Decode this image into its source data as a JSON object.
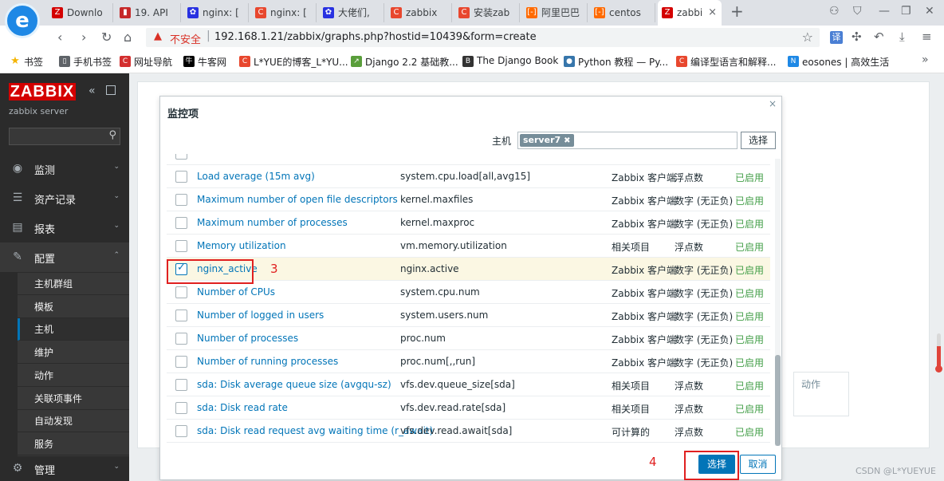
{
  "browser": {
    "tabs": [
      {
        "label": "Downlo",
        "icon": "zabbix-z-icon",
        "color": "#d40000"
      },
      {
        "label": "19. API",
        "icon": "book-icon",
        "color": "#c62828"
      },
      {
        "label": "nginx: [",
        "icon": "baidu-paw-icon",
        "color": "#2932e1"
      },
      {
        "label": "nginx: [",
        "icon": "csdn-c-icon",
        "color": "#e8472e"
      },
      {
        "label": "大佬们,",
        "icon": "baidu-paw-icon",
        "color": "#2932e1"
      },
      {
        "label": "zabbix",
        "icon": "csdn-c-icon",
        "color": "#e8472e"
      },
      {
        "label": "安装zab",
        "icon": "csdn-c-icon",
        "color": "#e8472e"
      },
      {
        "label": "阿里巴巴",
        "icon": "aliyun-icon",
        "color": "#ff6a00"
      },
      {
        "label": "centos",
        "icon": "aliyun-icon",
        "color": "#ff6a00"
      },
      {
        "label": "zabbi",
        "icon": "zabbix-z-icon",
        "color": "#d40000"
      }
    ],
    "active_tab_close": "×",
    "new_tab": "+",
    "logo_glyph": "e",
    "address": {
      "insecure_label": "不安全",
      "separator": "|",
      "url": "192.168.1.21/zabbix/graphs.php?hostid=10439&form=create"
    },
    "translate_label": "译",
    "bookmarks": [
      {
        "label": "书签",
        "icon": "star-icon",
        "color": "#f4b400"
      },
      {
        "label": "手机书签",
        "icon": "phone-icon",
        "color": "#5f6368"
      },
      {
        "label": "网址导航",
        "icon": "nav-icon",
        "color": "#d32f2f"
      },
      {
        "label": "牛客网",
        "icon": "nowcoder-icon",
        "color": "#000000"
      },
      {
        "label": "L*YUE的博客_L*YU...",
        "icon": "csdn-c-icon",
        "color": "#e8472e"
      },
      {
        "label": "Django 2.2 基础教...",
        "icon": "runoob-icon",
        "color": "#5a9e3b"
      },
      {
        "label": "The Django Book",
        "icon": "django-book-icon",
        "color": "#333333"
      },
      {
        "label": "Python 教程 — Py...",
        "icon": "python-icon",
        "color": "#3776ab"
      },
      {
        "label": "编译型语言和解释...",
        "icon": "csdn-c-icon",
        "color": "#e8472e"
      },
      {
        "label": "eosones | 高效生活",
        "icon": "eosones-icon",
        "color": "#1e88e5"
      }
    ],
    "bookmarks_more": "»"
  },
  "sidebar": {
    "logo": "ZABBIX",
    "server_name": "zabbix server",
    "menu": [
      {
        "label": "监测",
        "icon": "eye-icon"
      },
      {
        "label": "资产记录",
        "icon": "list-icon"
      },
      {
        "label": "报表",
        "icon": "chart-icon"
      },
      {
        "label": "配置",
        "icon": "wrench-icon"
      },
      {
        "label": "管理",
        "icon": "gear-icon"
      }
    ],
    "config_submenu": [
      "主机群组",
      "模板",
      "主机",
      "维护",
      "动作",
      "关联项事件",
      "自动发现",
      "服务"
    ],
    "selected_submenu": "主机"
  },
  "background": {
    "action_label": "动作"
  },
  "dialog": {
    "title": "监控项",
    "close": "×",
    "host_label": "主机",
    "host_tag": "server7",
    "host_tag_remove": "✖",
    "host_select_button": "选择",
    "items": [
      {
        "name": "Load average (15m avg)",
        "key": "system.cpu.load[all,avg15]",
        "type": "Zabbix 客户端",
        "value_type": "浮点数",
        "status": "已启用",
        "checked": false
      },
      {
        "name": "Maximum number of open file descriptors",
        "key": "kernel.maxfiles",
        "type": "Zabbix 客户端",
        "value_type": "数字 (无正负)",
        "status": "已启用",
        "checked": false
      },
      {
        "name": "Maximum number of processes",
        "key": "kernel.maxproc",
        "type": "Zabbix 客户端",
        "value_type": "数字 (无正负)",
        "status": "已启用",
        "checked": false
      },
      {
        "name": "Memory utilization",
        "key": "vm.memory.utilization",
        "type": "相关项目",
        "value_type": "浮点数",
        "status": "已启用",
        "checked": false
      },
      {
        "name": "nginx_active",
        "key": "nginx.active",
        "type": "Zabbix 客户端",
        "value_type": "数字 (无正负)",
        "status": "已启用",
        "checked": true
      },
      {
        "name": "Number of CPUs",
        "key": "system.cpu.num",
        "type": "Zabbix 客户端",
        "value_type": "数字 (无正负)",
        "status": "已启用",
        "checked": false
      },
      {
        "name": "Number of logged in users",
        "key": "system.users.num",
        "type": "Zabbix 客户端",
        "value_type": "数字 (无正负)",
        "status": "已启用",
        "checked": false
      },
      {
        "name": "Number of processes",
        "key": "proc.num",
        "type": "Zabbix 客户端",
        "value_type": "数字 (无正负)",
        "status": "已启用",
        "checked": false
      },
      {
        "name": "Number of running processes",
        "key": "proc.num[,,run]",
        "type": "Zabbix 客户端",
        "value_type": "数字 (无正负)",
        "status": "已启用",
        "checked": false
      },
      {
        "name": "sda: Disk average queue size (avgqu-sz)",
        "key": "vfs.dev.queue_size[sda]",
        "type": "相关项目",
        "value_type": "浮点数",
        "status": "已启用",
        "checked": false
      },
      {
        "name": "sda: Disk read rate",
        "key": "vfs.dev.read.rate[sda]",
        "type": "相关项目",
        "value_type": "浮点数",
        "status": "已启用",
        "checked": false
      },
      {
        "name": "sda: Disk read request avg waiting time (r_await)",
        "key": "vfs.dev.read.await[sda]",
        "type": "可计算的",
        "value_type": "浮点数",
        "status": "已启用",
        "checked": false
      }
    ],
    "annotation_step3": "3",
    "annotation_step4": "4",
    "select_button": "选择",
    "cancel_button": "取消",
    "status_color": "#429e47",
    "link_color": "#0275b8",
    "annotation_color": "#e02020"
  },
  "watermark": "CSDN @L*YUEYUE"
}
